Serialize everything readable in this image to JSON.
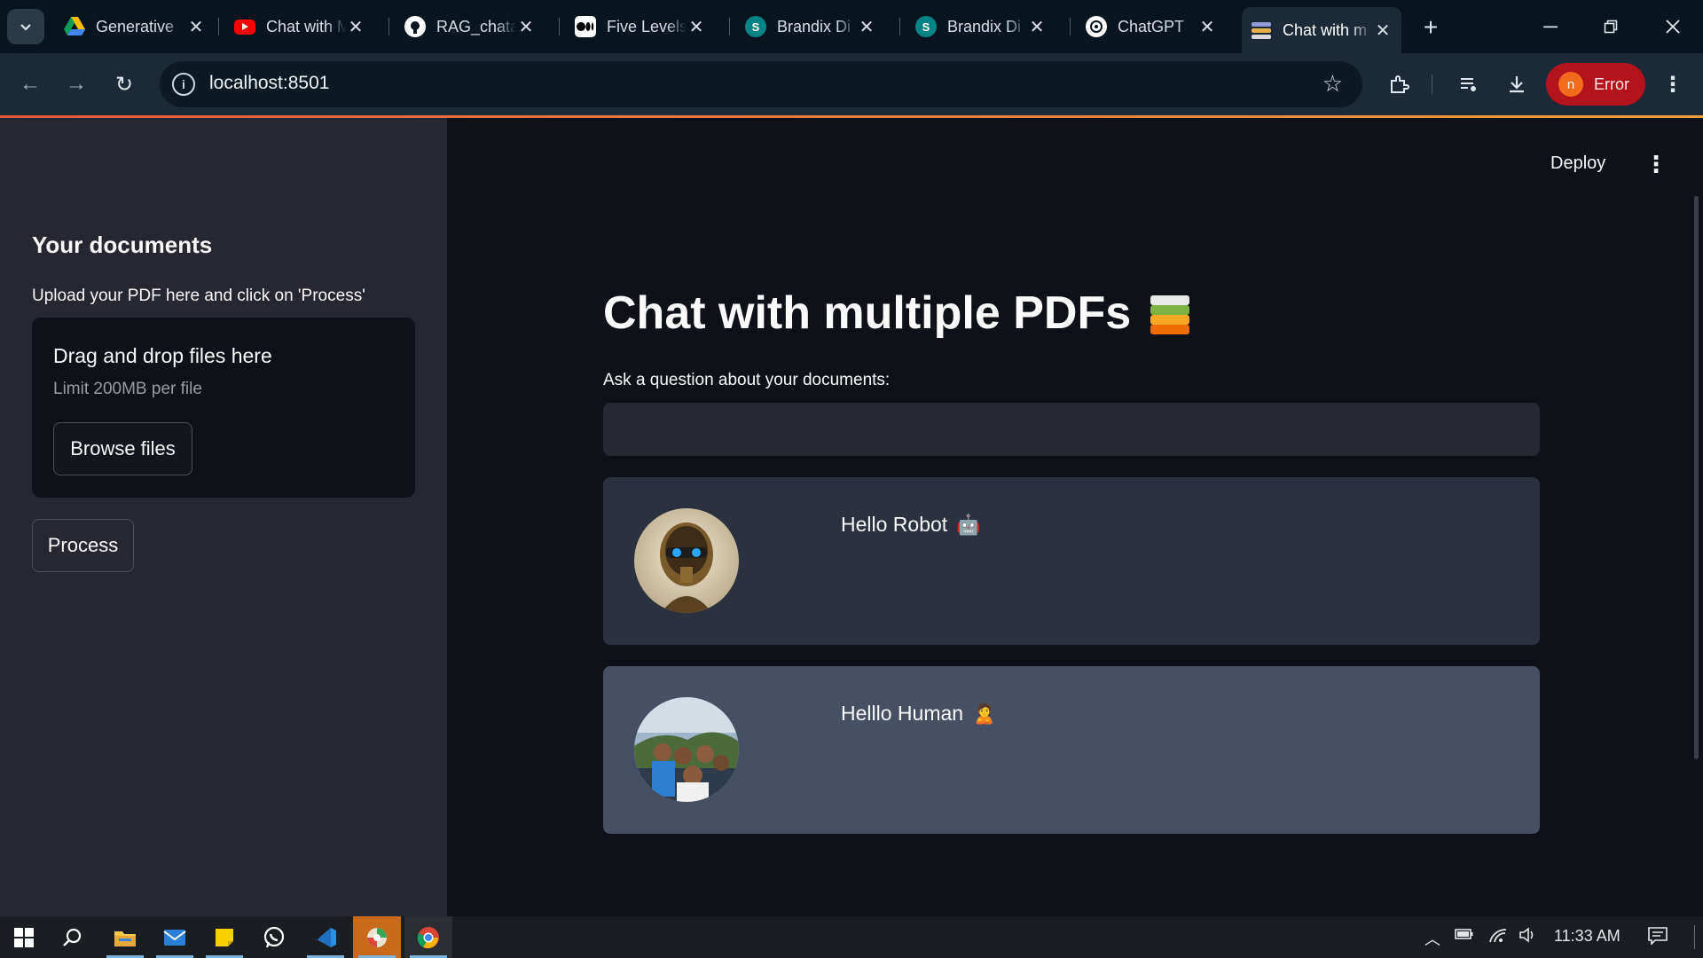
{
  "browser": {
    "tabs": [
      {
        "title": "Generative",
        "favicon": "google-drive-icon",
        "color": "#1a73e8",
        "active": false
      },
      {
        "title": "Chat with M",
        "favicon": "youtube-icon",
        "color": "#ff0000",
        "active": false
      },
      {
        "title": "RAG_chata",
        "favicon": "github-icon",
        "color": "#ffffff",
        "active": false
      },
      {
        "title": "Five Levels",
        "favicon": "medium-icon",
        "color": "#000000",
        "active": false
      },
      {
        "title": "Brandix Di",
        "favicon": "sharepoint-icon",
        "color": "#038387",
        "active": false
      },
      {
        "title": "Brandix Di",
        "favicon": "sharepoint-icon",
        "color": "#038387",
        "active": false
      },
      {
        "title": "ChatGPT",
        "favicon": "chatgpt-icon",
        "color": "#ffffff",
        "active": false
      },
      {
        "title": "Chat with m",
        "favicon": "books-icon",
        "color": "#8e9bd6",
        "active": true
      }
    ],
    "url": "localhost:8501",
    "profile_label": "Error",
    "profile_initial": "n"
  },
  "app": {
    "deploy_label": "Deploy",
    "sidebar": {
      "heading": "Your documents",
      "caption": "Upload your PDF here and click on 'Process'",
      "dropzone_title": "Drag and drop files here",
      "dropzone_limit": "Limit 200MB per file",
      "browse_label": "Browse files",
      "process_label": "Process"
    },
    "main": {
      "title": "Chat with multiple PDFs",
      "question_label": "Ask a question about your documents:",
      "question_value": "",
      "messages": [
        {
          "role": "bot",
          "text": "Hello Robot",
          "emoji": "🤖"
        },
        {
          "role": "user",
          "text": "Helllo Human",
          "emoji": "🙎"
        }
      ]
    }
  },
  "taskbar": {
    "apps": [
      "start-icon",
      "search-icon",
      "file-explorer-icon",
      "mail-icon",
      "sticky-notes-icon",
      "whatsapp-icon",
      "vscode-icon",
      "app-icon",
      "chrome-icon"
    ],
    "time": "11:33 AM"
  }
}
